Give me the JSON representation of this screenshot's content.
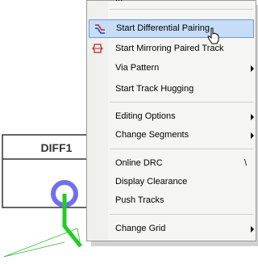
{
  "pcb": {
    "component_label": "DIFF1"
  },
  "menu": {
    "top_cut_label": "...",
    "items": [
      {
        "label": "Start Differential Pairing",
        "icon": "diff-pair-icon",
        "highlighted": true
      },
      {
        "label": "Start Mirroring Paired Track",
        "icon": "mirror-track-icon"
      },
      {
        "label": "Via Pattern",
        "submenu": true
      },
      {
        "label": "Start Track Hugging"
      },
      {
        "label": "Editing Options",
        "submenu": true
      },
      {
        "label": "Change Segments",
        "submenu": true
      },
      {
        "label": "Online DRC",
        "shortcut": "\\"
      },
      {
        "label": "Display Clearance"
      },
      {
        "label": "Push Tracks"
      },
      {
        "label": "Change Grid",
        "submenu": true
      }
    ]
  },
  "colors": {
    "highlight_bg": "#c7dcf6",
    "highlight_border": "#6d9bd6",
    "trace_green": "#22cc22",
    "pad_ring": "#7070ee"
  }
}
